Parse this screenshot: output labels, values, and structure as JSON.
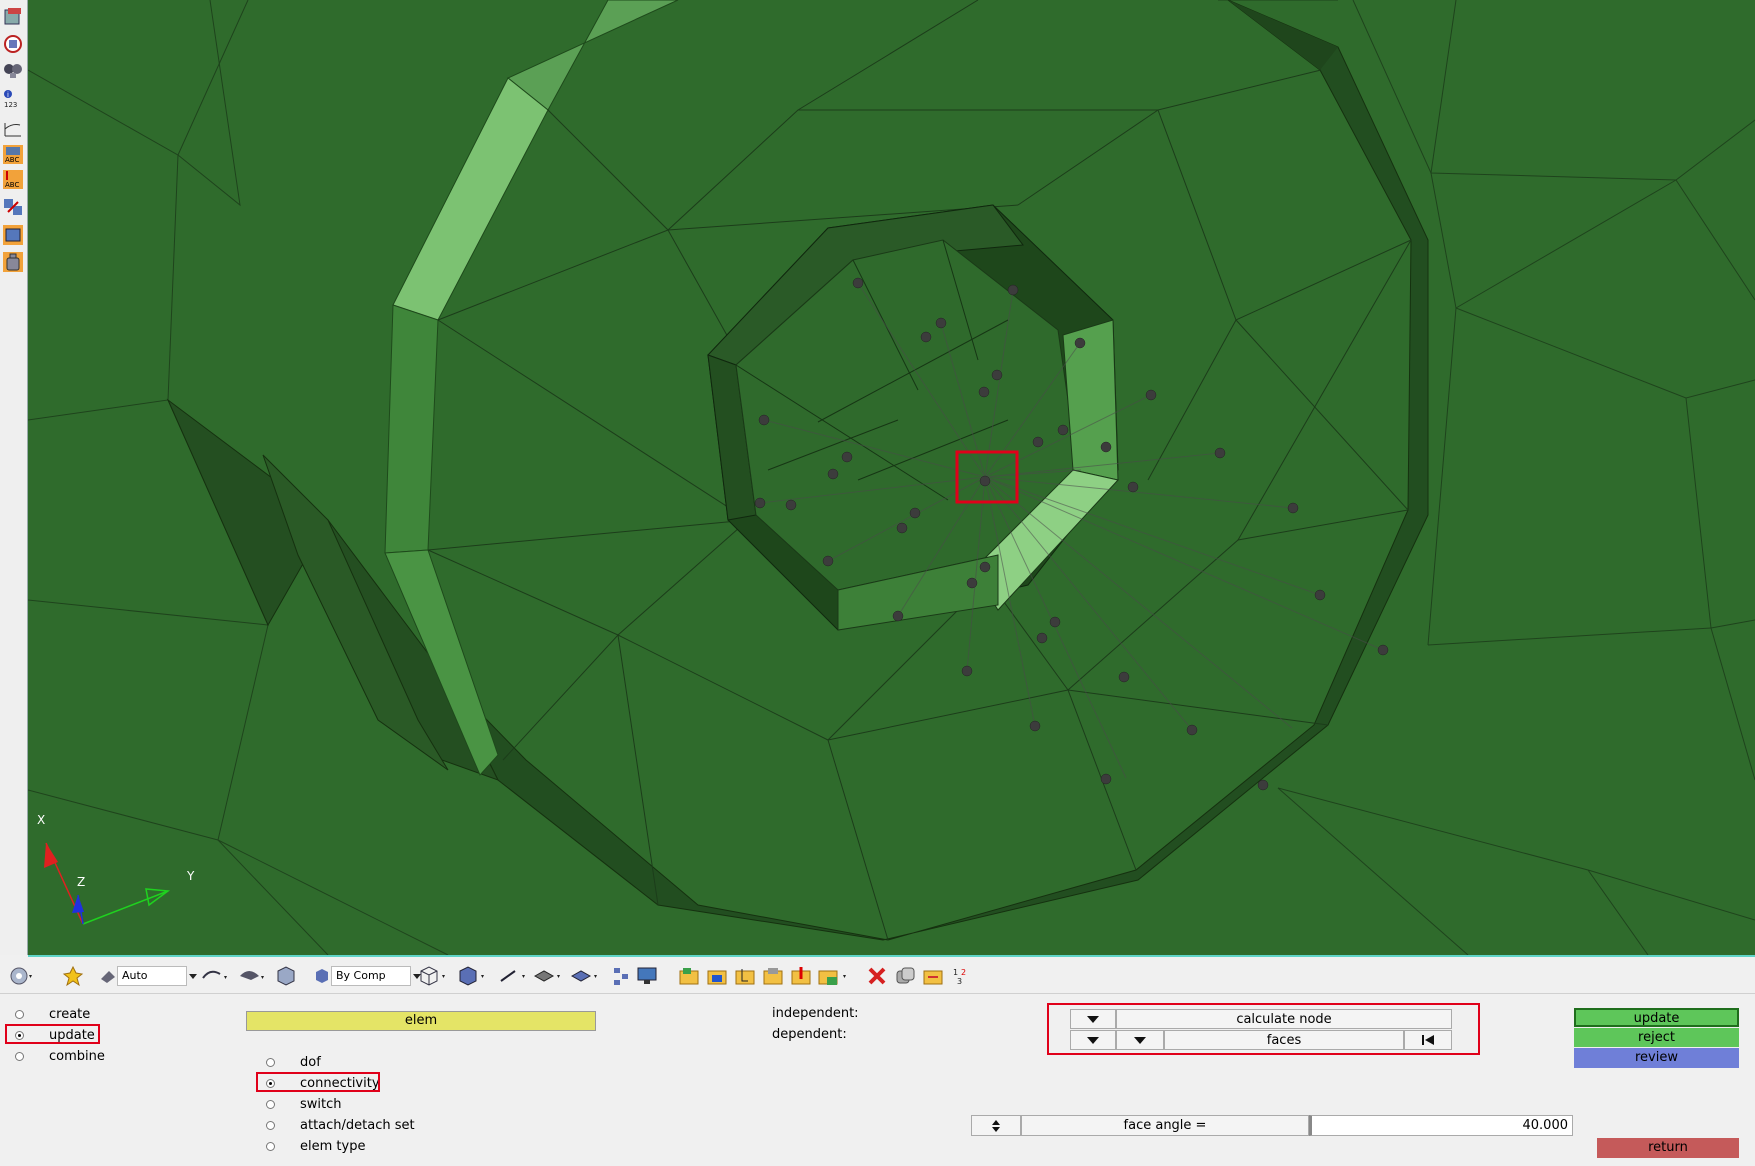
{
  "left_toolbar": {
    "icons": [
      "model-browser-icon",
      "entity-state-icon",
      "find-icon",
      "id-info-icon",
      "measure-icon",
      "label-abc-icon",
      "label-abc-2-icon",
      "transform-icon",
      "mesh-edit-icon",
      "mass-icon"
    ],
    "id_label": "123"
  },
  "triad": {
    "x": "X",
    "y": "Y",
    "z": "Z"
  },
  "bottom_toolbar": {
    "auto_label": "Auto",
    "color_mode_label": "By Comp"
  },
  "panel": {
    "modes": [
      {
        "label": "create",
        "selected": false
      },
      {
        "label": "update",
        "selected": true
      },
      {
        "label": "combine",
        "selected": false
      }
    ],
    "entity_selector": "elem",
    "sub_modes": [
      {
        "label": "dof",
        "selected": false
      },
      {
        "label": "connectivity",
        "selected": true
      },
      {
        "label": "switch",
        "selected": false
      },
      {
        "label": "attach/detach set",
        "selected": false
      },
      {
        "label": "elem type",
        "selected": false
      }
    ],
    "independent_label": "independent:",
    "dependent_label": "dependent:",
    "independent_value": "calculate node",
    "dependent_value": "faces",
    "face_angle_label": "face angle =",
    "face_angle_value": "40.000",
    "buttons": {
      "update": "update",
      "reject": "reject",
      "review": "review",
      "return": "return"
    }
  },
  "colors": {
    "viewport_bg": "#2f6b2c",
    "highlight": "#e0001a",
    "update_btn": "#5ec65a",
    "review_btn": "#6f7fd8",
    "return_btn": "#c55a5a",
    "elem_btn": "#e4e466"
  }
}
